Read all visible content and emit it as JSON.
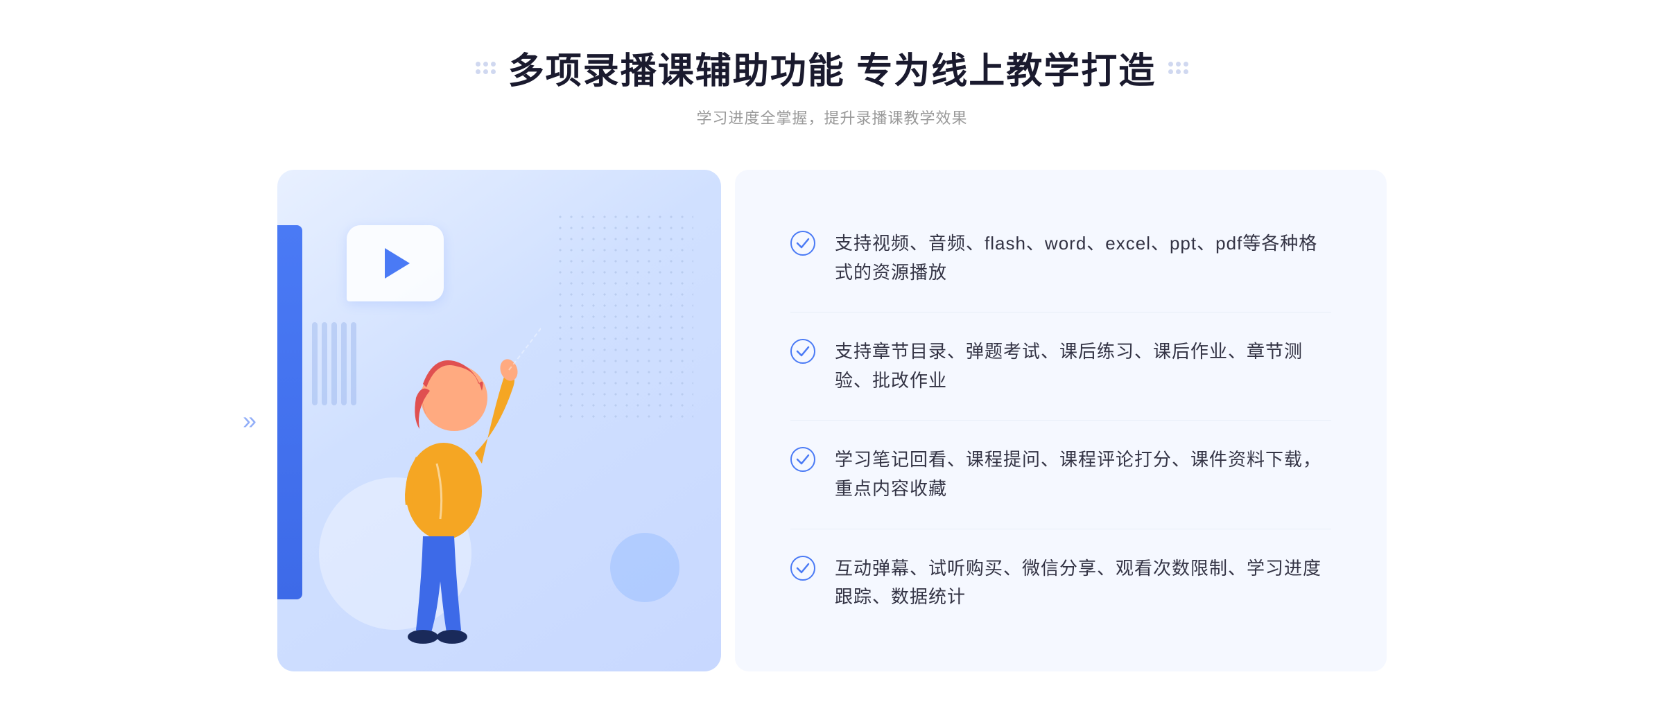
{
  "header": {
    "title": "多项录播课辅助功能 专为线上教学打造",
    "subtitle": "学习进度全掌握，提升录播课教学效果"
  },
  "features": [
    {
      "id": 1,
      "text": "支持视频、音频、flash、word、excel、ppt、pdf等各种格式的资源播放"
    },
    {
      "id": 2,
      "text": "支持章节目录、弹题考试、课后练习、课后作业、章节测验、批改作业"
    },
    {
      "id": 3,
      "text": "学习笔记回看、课程提问、课程评论打分、课件资料下载，重点内容收藏"
    },
    {
      "id": 4,
      "text": "互动弹幕、试听购买、微信分享、观看次数限制、学习进度跟踪、数据统计"
    }
  ],
  "illustration": {
    "play_label": "播放",
    "chevron_label": "»"
  }
}
